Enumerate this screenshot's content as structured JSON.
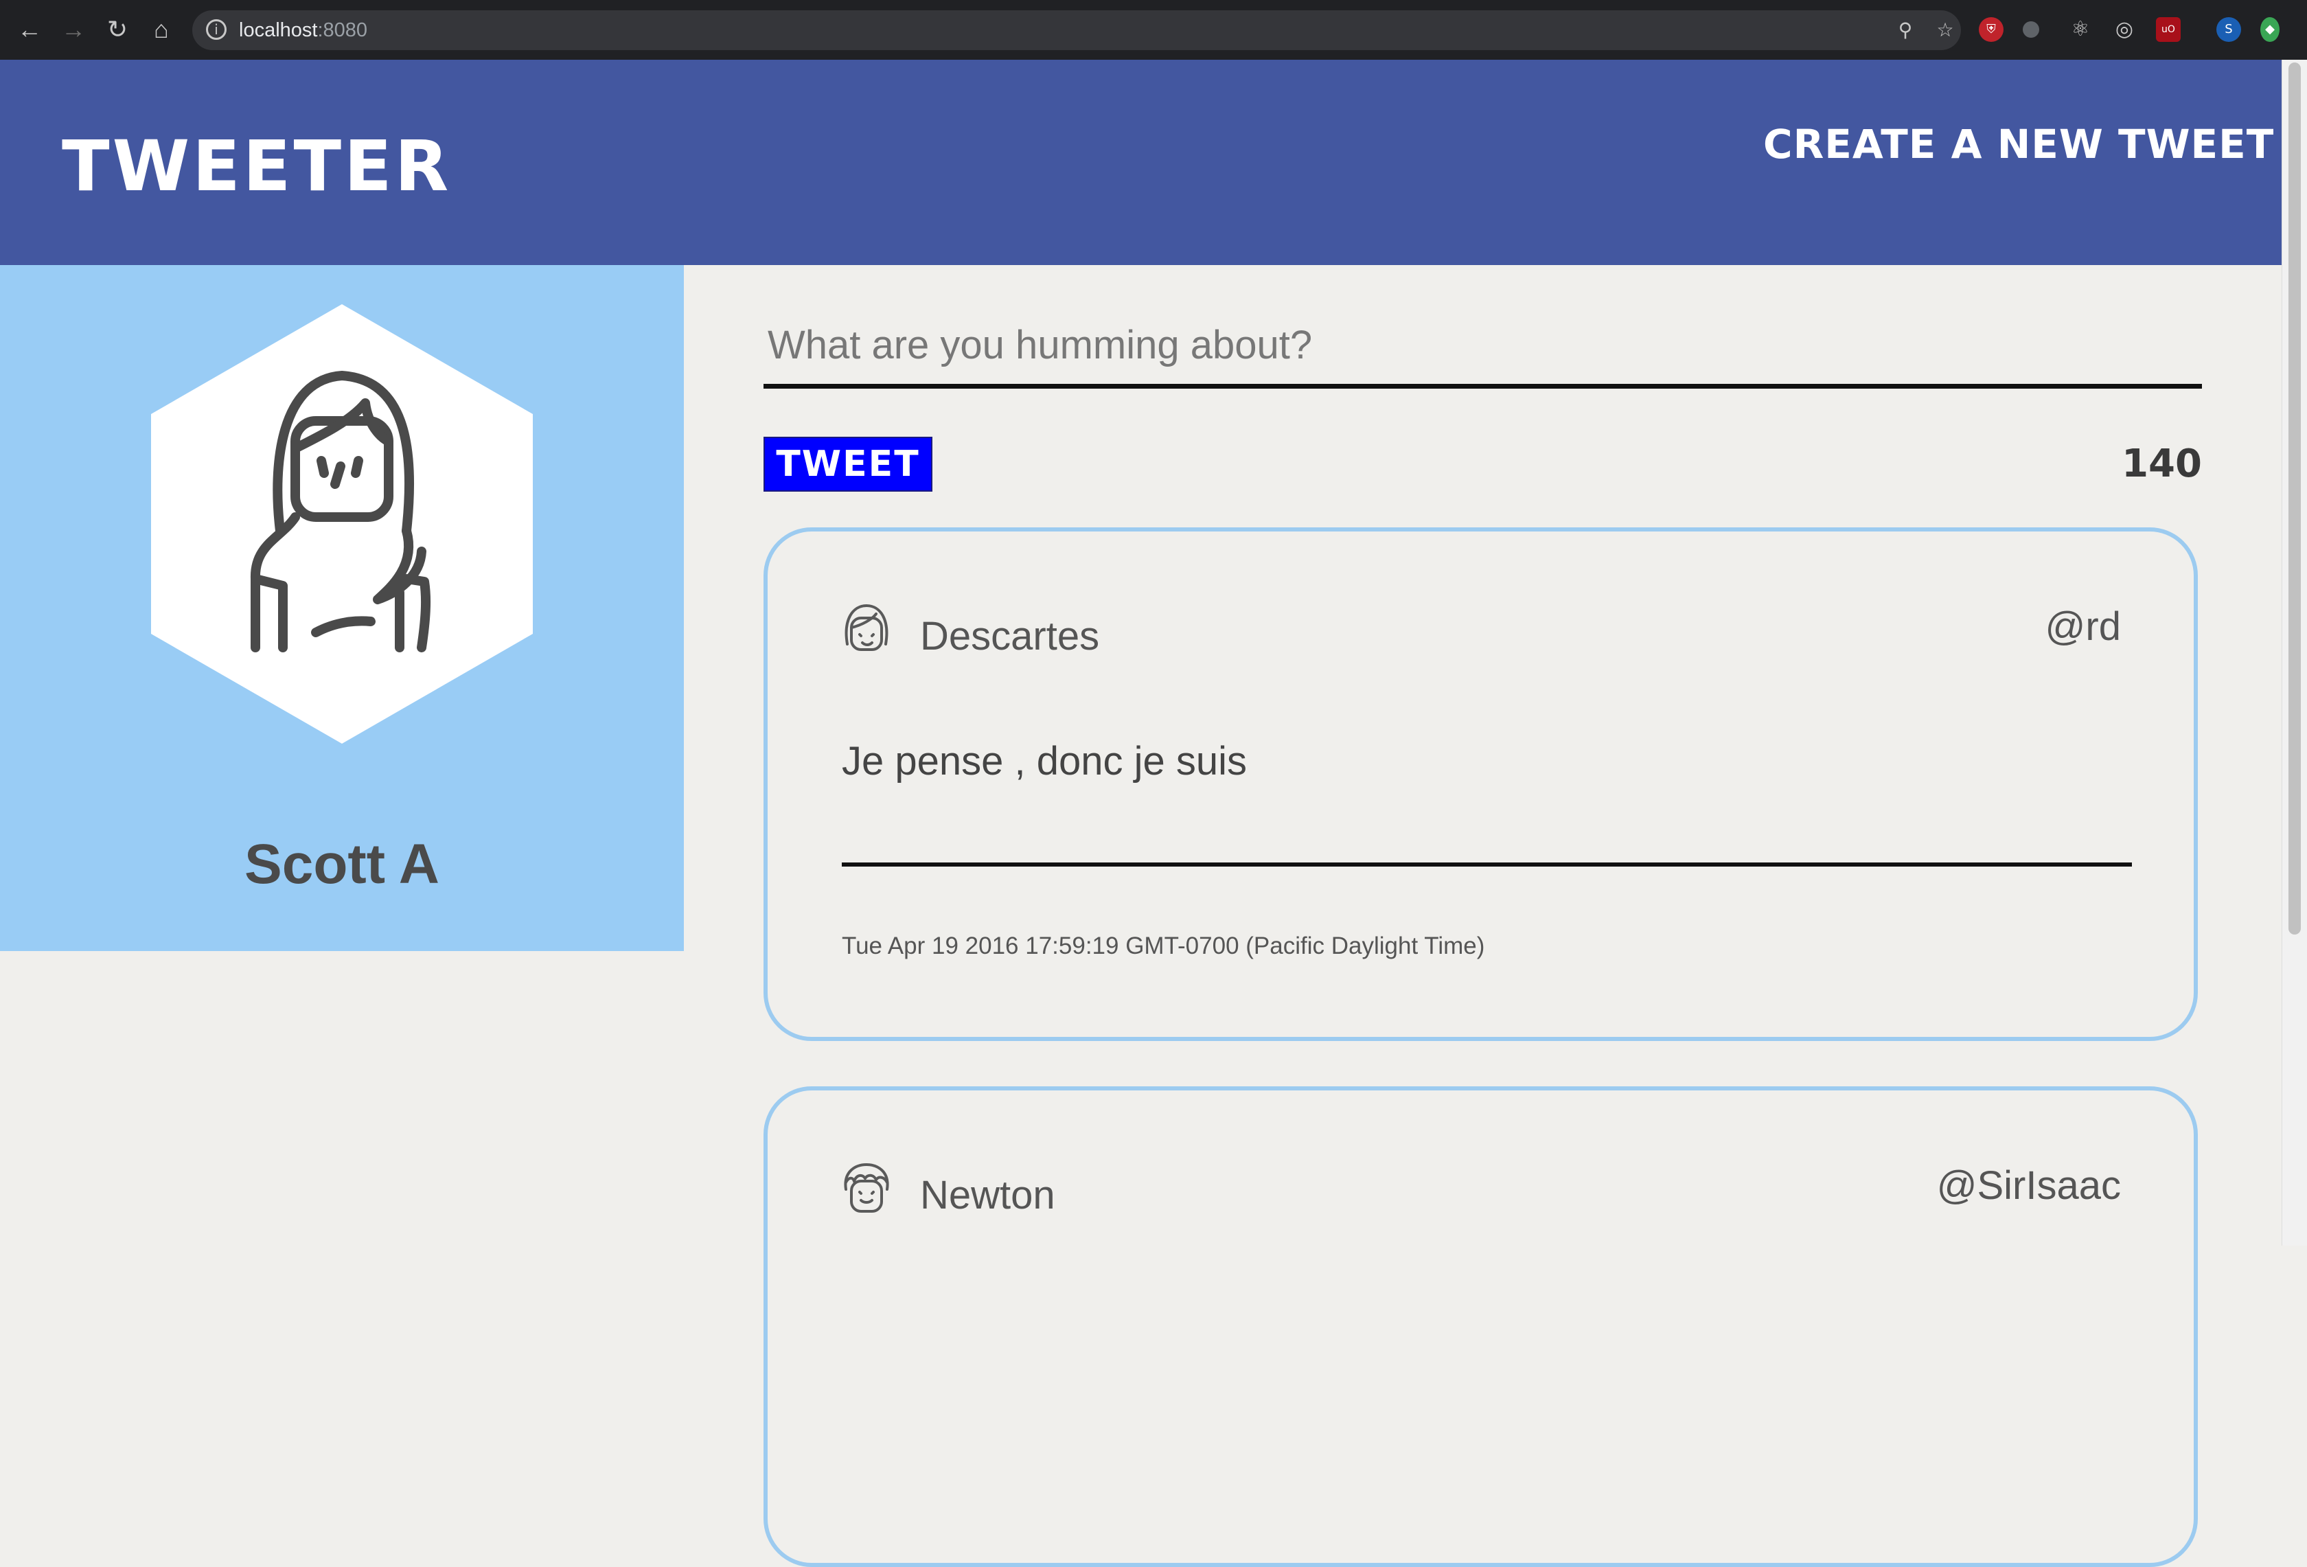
{
  "browser": {
    "url_host": "localhost",
    "url_port": ":8080",
    "info_icon": "info-icon",
    "nav": [
      "back-arrow-icon",
      "forward-arrow-icon",
      "reload-icon",
      "home-icon"
    ],
    "omnibox_icons": [
      "zoom-icon",
      "bookmark-star-icon"
    ],
    "extensions": [
      {
        "name": "shield-extension-icon",
        "color": "#c0232b",
        "glyph": "⛨"
      },
      {
        "name": "bug-extension-icon",
        "color": "#5f6368",
        "glyph": "●"
      },
      {
        "name": "react-extension-icon",
        "color": "#202124",
        "glyph": "⚛"
      },
      {
        "name": "target-extension-icon",
        "color": "#202124",
        "glyph": "◎"
      },
      {
        "name": "ublock-extension-icon",
        "color": "#a8101a",
        "glyph": "uO"
      },
      {
        "name": "profile-avatar",
        "color": "#1a5fb4",
        "glyph": "S"
      },
      {
        "name": "green-extension-icon",
        "color": "#3aa655",
        "glyph": "◆"
      }
    ]
  },
  "header": {
    "logo": "Tweeter",
    "compose_link": "Create a new tweet"
  },
  "profile": {
    "name": "Scott A"
  },
  "composer": {
    "placeholder": "What are you humming about?",
    "button_label": "Tweet",
    "char_count": "140"
  },
  "tweets": [
    {
      "author": "Descartes",
      "handle": "@rd",
      "body": "Je pense , donc je suis",
      "timestamp": "Tue Apr 19 2016 17:59:19 GMT-0700 (Pacific Daylight Time)"
    },
    {
      "author": "Newton",
      "handle": "@SirIsaac"
    }
  ],
  "colors": {
    "header_bg": "#4357a0",
    "profile_bg": "#99ccf5",
    "page_bg": "#f0efec",
    "tweet_button": "#0000ff",
    "card_border": "#9ccbf0"
  }
}
